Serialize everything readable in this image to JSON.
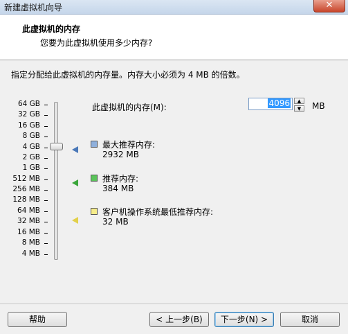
{
  "window": {
    "title": "新建虚拟机向导",
    "close_glyph": "✕"
  },
  "header": {
    "title": "此虚拟机的内存",
    "subtitle": "您要为此虚拟机使用多少内存?"
  },
  "instruction": "指定分配给此虚拟机的内存量。内存大小必须为 4 MB 的倍数。",
  "slider": {
    "ticks": [
      "64 GB",
      "32 GB",
      "16 GB",
      "8 GB",
      "4 GB",
      "2 GB",
      "1 GB",
      "512 MB",
      "256 MB",
      "128 MB",
      "64 MB",
      "32 MB",
      "16 MB",
      "8 MB",
      "4 MB"
    ],
    "selected": "4 GB"
  },
  "memory": {
    "label": "此虚拟机的内存(M):",
    "value": "4096",
    "unit": "MB"
  },
  "legend": [
    {
      "title": "最大推荐内存:",
      "value": "2932 MB",
      "color": "#4a78b8"
    },
    {
      "title": "推荐内存:",
      "value": "384 MB",
      "color": "#3aa63a"
    },
    {
      "title": "客户机操作系统最低推荐内存:",
      "value": "32 MB",
      "color": "#e2d04a"
    }
  ],
  "buttons": {
    "help": "帮助",
    "back": "< 上一步(B)",
    "next": "下一步(N) >",
    "cancel": "取消"
  }
}
